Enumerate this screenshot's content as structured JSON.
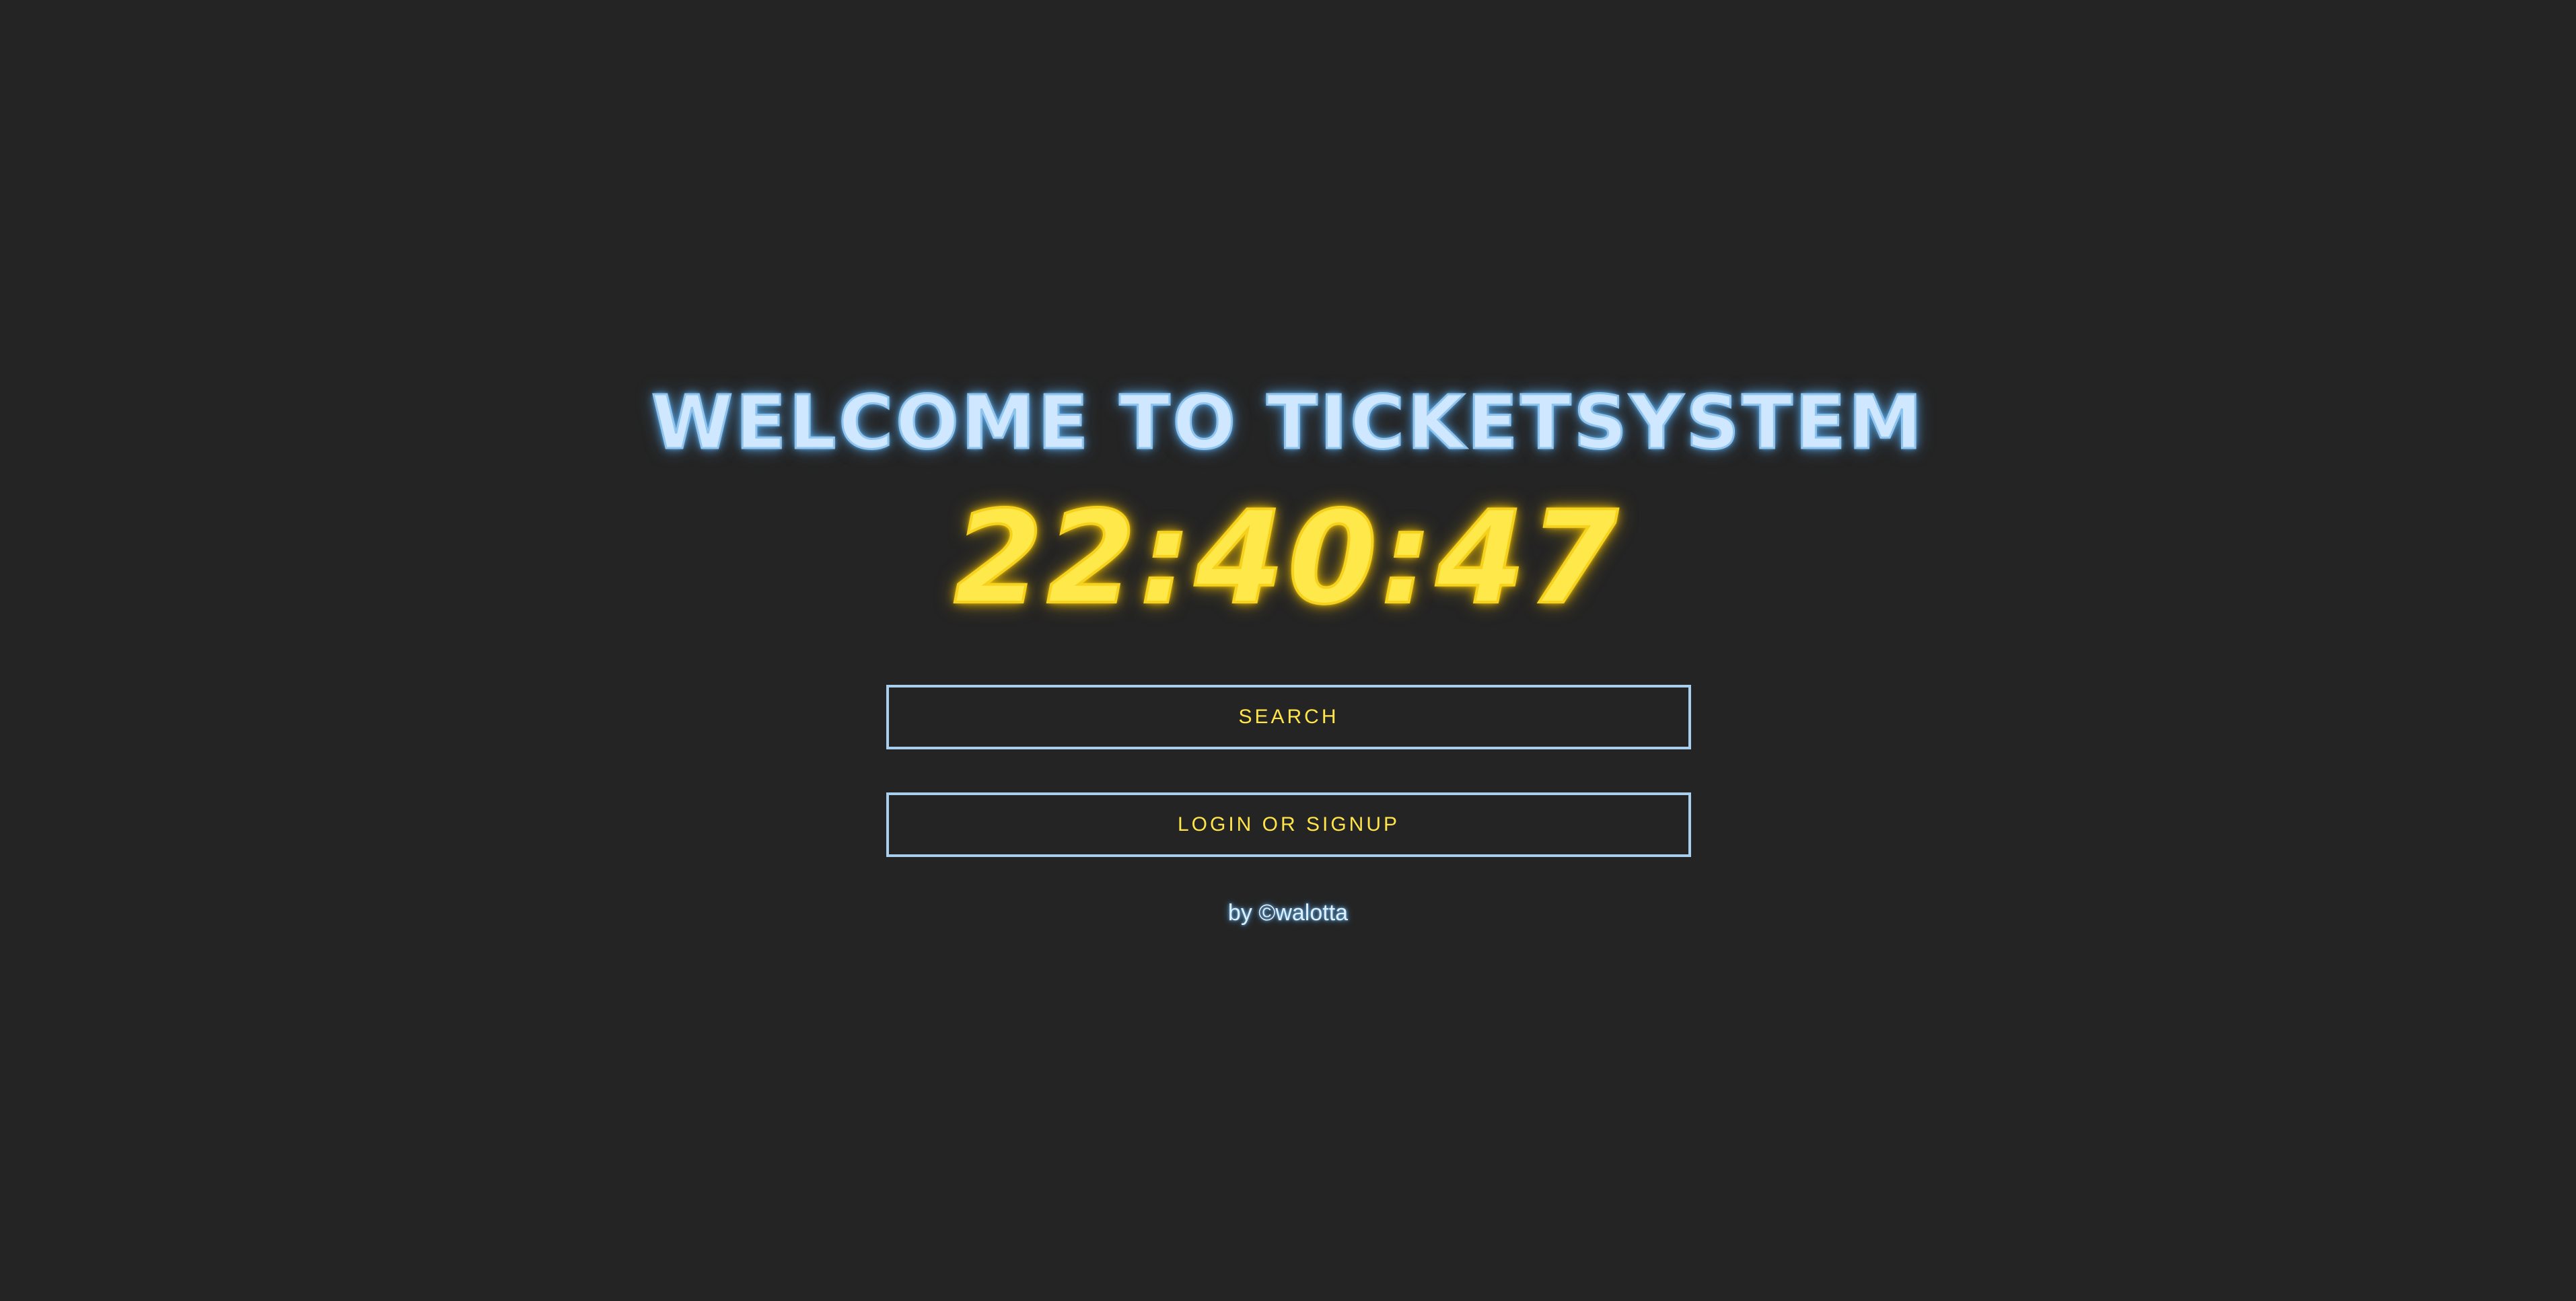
{
  "header": {
    "title": "WELCOME TO TICKETSYSTEM"
  },
  "clock": {
    "time": "22:40:47"
  },
  "buttons": {
    "search_label": "SEARCH",
    "login_label": "LOGIN OR SIGNUP"
  },
  "footer": {
    "credit": "by ©walotta"
  },
  "colors": {
    "background": "#242424",
    "title_neon": "#8fc4ef",
    "clock_neon": "#ffe44a",
    "button_border": "#a9cfee",
    "button_text": "#ffe44a"
  }
}
